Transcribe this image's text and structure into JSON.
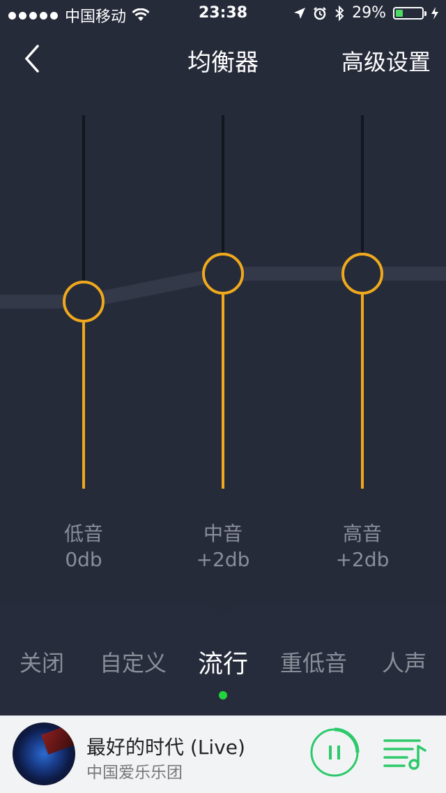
{
  "status_bar": {
    "signal_dots": 5,
    "carrier": "中国移动",
    "time": "23:38",
    "battery_text": "29%",
    "battery_level": 0.29,
    "icons": [
      "wifi-icon",
      "location-icon",
      "alarm-icon",
      "bluetooth-icon",
      "battery-icon",
      "charging-icon"
    ]
  },
  "header": {
    "title": "均衡器",
    "advanced_label": "高级设置"
  },
  "equalizer": {
    "bands": [
      {
        "label": "低音",
        "value_text": "0db",
        "gain_db": 0
      },
      {
        "label": "中音",
        "value_text": "+2db",
        "gain_db": 2
      },
      {
        "label": "高音",
        "value_text": "+2db",
        "gain_db": 2
      }
    ],
    "accent_color": "#f0a91c"
  },
  "presets": {
    "items": [
      "关闭",
      "自定义",
      "流行",
      "重低音",
      "人声"
    ],
    "selected": "流行",
    "indicator_color": "#22d43d"
  },
  "player": {
    "song_title": "最好的时代 (Live)",
    "artist": "中国爱乐乐团",
    "accent_color": "#2cc96a"
  }
}
